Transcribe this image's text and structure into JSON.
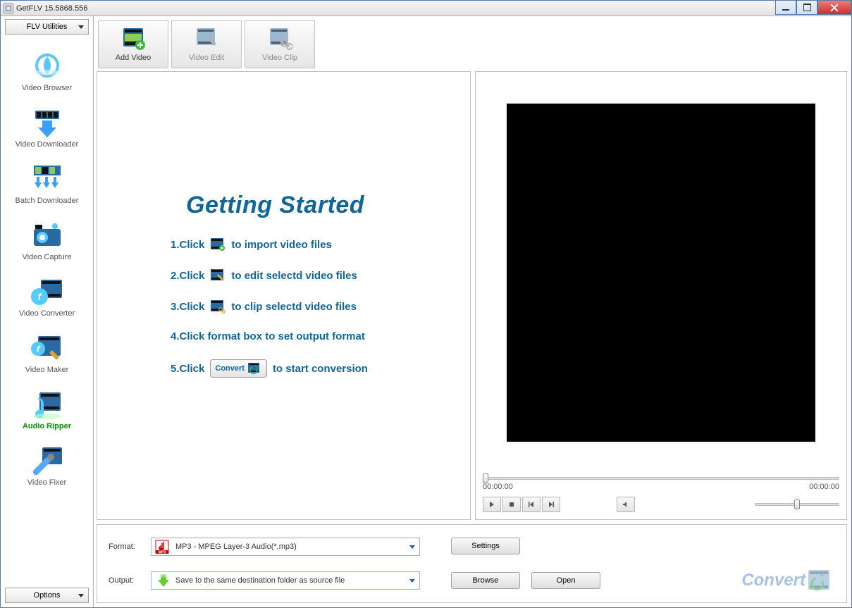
{
  "title": "GetFLV 15.5868.556",
  "sidebar": {
    "topDropdown": "FLV Utilities",
    "items": [
      {
        "label": "Video Browser"
      },
      {
        "label": "Video Downloader"
      },
      {
        "label": "Batch Downloader"
      },
      {
        "label": "Video Capture"
      },
      {
        "label": "Video Converter"
      },
      {
        "label": "Video Maker"
      },
      {
        "label": "Audio Ripper"
      },
      {
        "label": "Video Fixer"
      }
    ],
    "bottomDropdown": "Options"
  },
  "toolbar": {
    "addVideo": "Add Video",
    "videoEdit": "Video Edit",
    "videoClip": "Video Clip"
  },
  "guide": {
    "title": "Getting Started",
    "step1a": "1.Click",
    "step1b": "to import video files",
    "step2a": "2.Click",
    "step2b": "to edit selectd video files",
    "step3a": "3.Click",
    "step3b": "to clip selectd video files",
    "step4": "4.Click format box to set output format",
    "step5a": "5.Click",
    "step5btn": "Convert",
    "step5b": "to start conversion"
  },
  "preview": {
    "timeStart": "00:00:00",
    "timeEnd": "00:00:00"
  },
  "bottom": {
    "formatLabel": "Format:",
    "formatValue": "MP3 - MPEG Layer-3 Audio(*.mp3)",
    "outputLabel": "Output:",
    "outputValue": "Save to the same destination folder as source file",
    "settings": "Settings",
    "browse": "Browse",
    "open": "Open",
    "convert": "Convert"
  }
}
